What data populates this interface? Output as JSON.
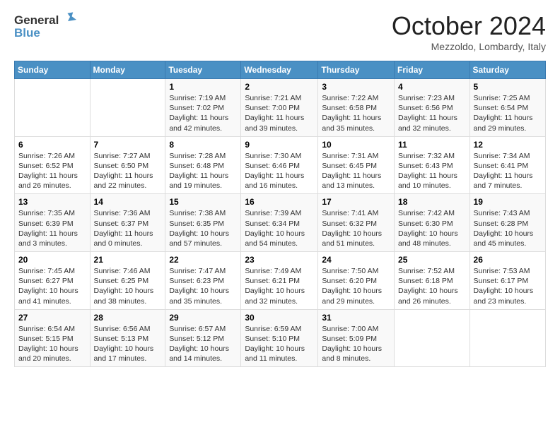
{
  "header": {
    "logo_line1": "General",
    "logo_line2": "Blue",
    "month": "October 2024",
    "location": "Mezzoldo, Lombardy, Italy"
  },
  "weekdays": [
    "Sunday",
    "Monday",
    "Tuesday",
    "Wednesday",
    "Thursday",
    "Friday",
    "Saturday"
  ],
  "weeks": [
    [
      {
        "day": "",
        "info": ""
      },
      {
        "day": "",
        "info": ""
      },
      {
        "day": "1",
        "info": "Sunrise: 7:19 AM\nSunset: 7:02 PM\nDaylight: 11 hours and 42 minutes."
      },
      {
        "day": "2",
        "info": "Sunrise: 7:21 AM\nSunset: 7:00 PM\nDaylight: 11 hours and 39 minutes."
      },
      {
        "day": "3",
        "info": "Sunrise: 7:22 AM\nSunset: 6:58 PM\nDaylight: 11 hours and 35 minutes."
      },
      {
        "day": "4",
        "info": "Sunrise: 7:23 AM\nSunset: 6:56 PM\nDaylight: 11 hours and 32 minutes."
      },
      {
        "day": "5",
        "info": "Sunrise: 7:25 AM\nSunset: 6:54 PM\nDaylight: 11 hours and 29 minutes."
      }
    ],
    [
      {
        "day": "6",
        "info": "Sunrise: 7:26 AM\nSunset: 6:52 PM\nDaylight: 11 hours and 26 minutes."
      },
      {
        "day": "7",
        "info": "Sunrise: 7:27 AM\nSunset: 6:50 PM\nDaylight: 11 hours and 22 minutes."
      },
      {
        "day": "8",
        "info": "Sunrise: 7:28 AM\nSunset: 6:48 PM\nDaylight: 11 hours and 19 minutes."
      },
      {
        "day": "9",
        "info": "Sunrise: 7:30 AM\nSunset: 6:46 PM\nDaylight: 11 hours and 16 minutes."
      },
      {
        "day": "10",
        "info": "Sunrise: 7:31 AM\nSunset: 6:45 PM\nDaylight: 11 hours and 13 minutes."
      },
      {
        "day": "11",
        "info": "Sunrise: 7:32 AM\nSunset: 6:43 PM\nDaylight: 11 hours and 10 minutes."
      },
      {
        "day": "12",
        "info": "Sunrise: 7:34 AM\nSunset: 6:41 PM\nDaylight: 11 hours and 7 minutes."
      }
    ],
    [
      {
        "day": "13",
        "info": "Sunrise: 7:35 AM\nSunset: 6:39 PM\nDaylight: 11 hours and 3 minutes."
      },
      {
        "day": "14",
        "info": "Sunrise: 7:36 AM\nSunset: 6:37 PM\nDaylight: 11 hours and 0 minutes."
      },
      {
        "day": "15",
        "info": "Sunrise: 7:38 AM\nSunset: 6:35 PM\nDaylight: 10 hours and 57 minutes."
      },
      {
        "day": "16",
        "info": "Sunrise: 7:39 AM\nSunset: 6:34 PM\nDaylight: 10 hours and 54 minutes."
      },
      {
        "day": "17",
        "info": "Sunrise: 7:41 AM\nSunset: 6:32 PM\nDaylight: 10 hours and 51 minutes."
      },
      {
        "day": "18",
        "info": "Sunrise: 7:42 AM\nSunset: 6:30 PM\nDaylight: 10 hours and 48 minutes."
      },
      {
        "day": "19",
        "info": "Sunrise: 7:43 AM\nSunset: 6:28 PM\nDaylight: 10 hours and 45 minutes."
      }
    ],
    [
      {
        "day": "20",
        "info": "Sunrise: 7:45 AM\nSunset: 6:27 PM\nDaylight: 10 hours and 41 minutes."
      },
      {
        "day": "21",
        "info": "Sunrise: 7:46 AM\nSunset: 6:25 PM\nDaylight: 10 hours and 38 minutes."
      },
      {
        "day": "22",
        "info": "Sunrise: 7:47 AM\nSunset: 6:23 PM\nDaylight: 10 hours and 35 minutes."
      },
      {
        "day": "23",
        "info": "Sunrise: 7:49 AM\nSunset: 6:21 PM\nDaylight: 10 hours and 32 minutes."
      },
      {
        "day": "24",
        "info": "Sunrise: 7:50 AM\nSunset: 6:20 PM\nDaylight: 10 hours and 29 minutes."
      },
      {
        "day": "25",
        "info": "Sunrise: 7:52 AM\nSunset: 6:18 PM\nDaylight: 10 hours and 26 minutes."
      },
      {
        "day": "26",
        "info": "Sunrise: 7:53 AM\nSunset: 6:17 PM\nDaylight: 10 hours and 23 minutes."
      }
    ],
    [
      {
        "day": "27",
        "info": "Sunrise: 6:54 AM\nSunset: 5:15 PM\nDaylight: 10 hours and 20 minutes."
      },
      {
        "day": "28",
        "info": "Sunrise: 6:56 AM\nSunset: 5:13 PM\nDaylight: 10 hours and 17 minutes."
      },
      {
        "day": "29",
        "info": "Sunrise: 6:57 AM\nSunset: 5:12 PM\nDaylight: 10 hours and 14 minutes."
      },
      {
        "day": "30",
        "info": "Sunrise: 6:59 AM\nSunset: 5:10 PM\nDaylight: 10 hours and 11 minutes."
      },
      {
        "day": "31",
        "info": "Sunrise: 7:00 AM\nSunset: 5:09 PM\nDaylight: 10 hours and 8 minutes."
      },
      {
        "day": "",
        "info": ""
      },
      {
        "day": "",
        "info": ""
      }
    ]
  ]
}
